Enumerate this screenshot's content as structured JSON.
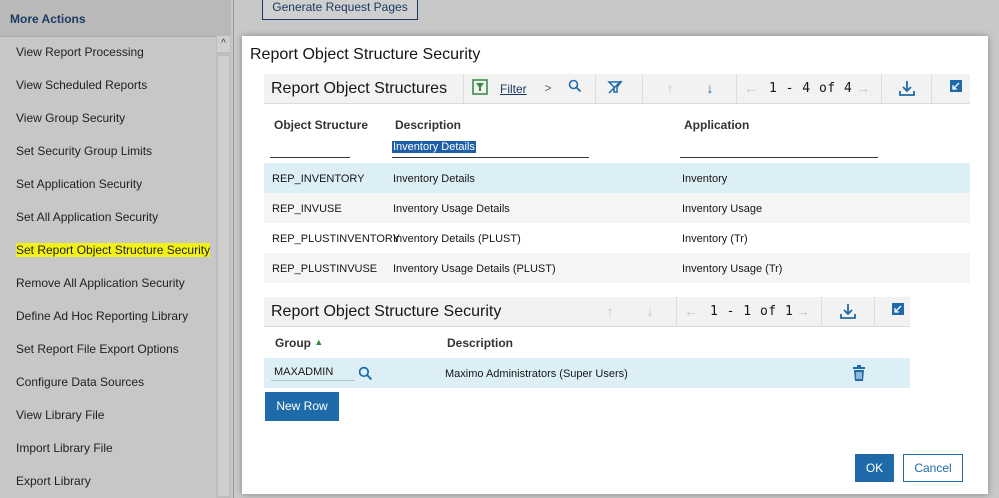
{
  "sidebar": {
    "header": "More Actions",
    "items": [
      {
        "label": "View Report Processing"
      },
      {
        "label": "View Scheduled Reports"
      },
      {
        "label": "View Group Security"
      },
      {
        "label": "Set Security Group Limits"
      },
      {
        "label": "Set Application Security"
      },
      {
        "label": "Set All Application Security"
      },
      {
        "label": "Set Report Object Structure Security",
        "highlighted": true
      },
      {
        "label": "Remove All Application Security"
      },
      {
        "label": "Define Ad Hoc Reporting Library"
      },
      {
        "label": "Set Report File Export Options"
      },
      {
        "label": "Configure Data Sources"
      },
      {
        "label": "View Library File"
      },
      {
        "label": "Import Library File"
      },
      {
        "label": "Export Library"
      }
    ],
    "highlight_color": "#f2f218"
  },
  "background_button": {
    "label": "Generate Request Pages"
  },
  "dialog": {
    "title": "Report Object Structure Security",
    "structures": {
      "title": "Report Object Structures",
      "filter_label": "Filter",
      "count": "1 - 4 of 4",
      "columns": [
        "Object Structure",
        "Description",
        "Application"
      ],
      "filter_value": "Inventory Details",
      "rows": [
        {
          "object_structure": "REP_INVENTORY",
          "description": "Inventory Details",
          "application": "Inventory"
        },
        {
          "object_structure": "REP_INVUSE",
          "description": "Inventory Usage Details",
          "application": "Inventory Usage"
        },
        {
          "object_structure": "REP_PLUSTINVENTORY",
          "description": "Inventory Details (PLUST)",
          "application": "Inventory (Tr)"
        },
        {
          "object_structure": "REP_PLUSTINVUSE",
          "description": "Inventory Usage Details (PLUST)",
          "application": "Inventory Usage (Tr)"
        }
      ]
    },
    "security": {
      "title": "Report Object Structure Security",
      "count": "1 - 1 of 1",
      "columns": [
        "Group",
        "Description"
      ],
      "rows": [
        {
          "group": "MAXADMIN",
          "description": "Maximo Administrators (Super Users)"
        }
      ],
      "new_row_label": "New Row"
    },
    "ok_label": "OK",
    "cancel_label": "Cancel"
  },
  "colors": {
    "primary": "#1f6aa8",
    "selected_row": "#dceff7",
    "filter_icon_green": "#2e8b3c"
  }
}
